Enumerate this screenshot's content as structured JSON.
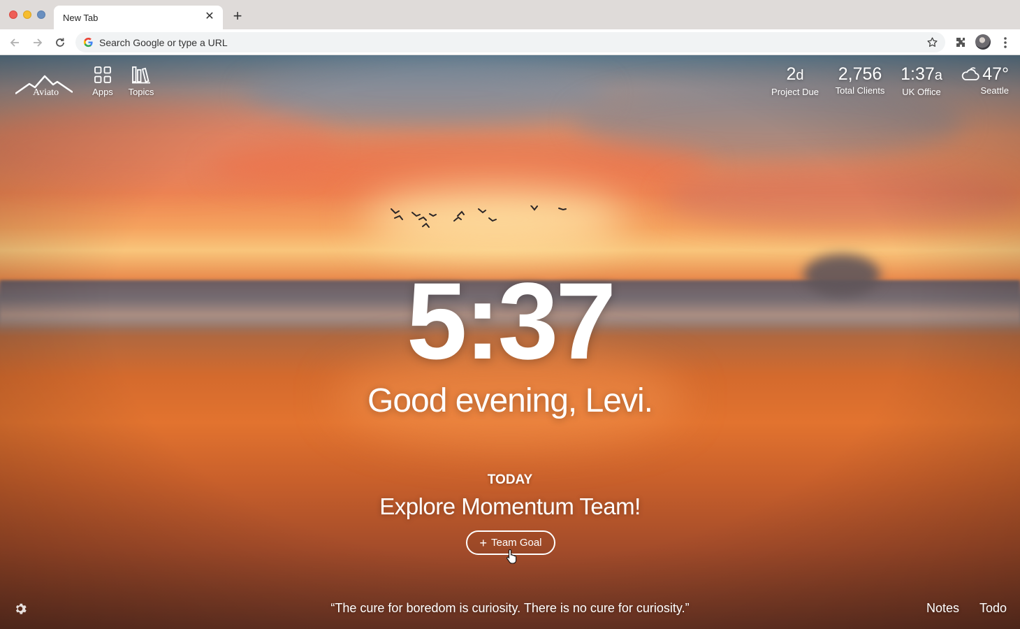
{
  "browser": {
    "tab_title": "New Tab",
    "omnibox_placeholder": "Search Google or type a URL"
  },
  "brand": {
    "name": "Aviato"
  },
  "nav": [
    {
      "label": "Apps",
      "icon": "apps-grid-icon"
    },
    {
      "label": "Topics",
      "icon": "topics-books-icon"
    }
  ],
  "metrics": [
    {
      "value": "2",
      "unit": "d",
      "label": "Project Due"
    },
    {
      "value": "2,756",
      "unit": "",
      "label": "Total Clients"
    },
    {
      "value": "1:37",
      "unit": "a",
      "label": "UK Office"
    }
  ],
  "weather": {
    "temp": "47°",
    "location": "Seattle",
    "icon": "cloud-icon"
  },
  "clock": "5:37",
  "greeting": "Good evening, Levi.",
  "focus": {
    "label": "TODAY",
    "text": "Explore Momentum Team!",
    "button_label": "Team Goal"
  },
  "quote": "“The cure for boredom is curiosity. There is no cure for curiosity.”",
  "bottom_links": {
    "notes": "Notes",
    "todo": "Todo"
  },
  "colors": {
    "text": "#ffffff",
    "chrome": "#dfdbd9",
    "omnibox": "#f1f3f4"
  }
}
